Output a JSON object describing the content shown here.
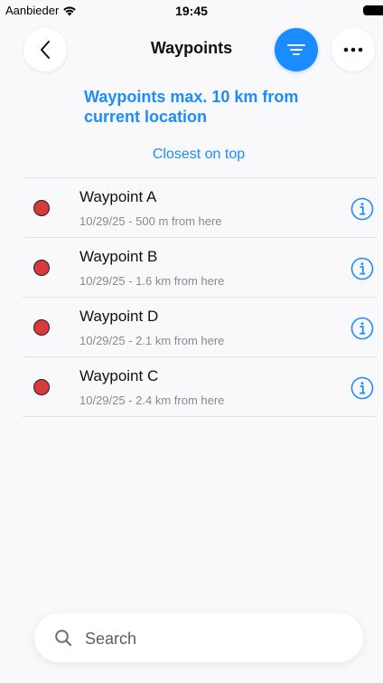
{
  "status_bar": {
    "carrier": "Aanbieder",
    "time": "19:45"
  },
  "nav": {
    "title": "Waypoints"
  },
  "info_banner": "Waypoints max. 10 km from current location",
  "sort_label": "Closest on top",
  "waypoints": [
    {
      "name": "Waypoint A",
      "subtitle": "10/29/25 - 500 m from here"
    },
    {
      "name": "Waypoint B",
      "subtitle": "10/29/25 - 1.6 km from here"
    },
    {
      "name": "Waypoint D",
      "subtitle": "10/29/25 - 2.1 km from here"
    },
    {
      "name": "Waypoint C",
      "subtitle": "10/29/25 - 2.4 km from here"
    }
  ],
  "search": {
    "placeholder": "Search",
    "value": ""
  },
  "icons": {
    "back": "chevron-left-icon",
    "filter": "filter-lines-icon",
    "more": "ellipsis-icon",
    "info": "info-circle-icon",
    "search": "magnifier-icon",
    "wifi": "wifi-icon",
    "battery": "battery-icon"
  },
  "colors": {
    "accent": "#1a8cff",
    "waypoint_dot": "#d63a3a",
    "background": "#f9f9fb"
  }
}
